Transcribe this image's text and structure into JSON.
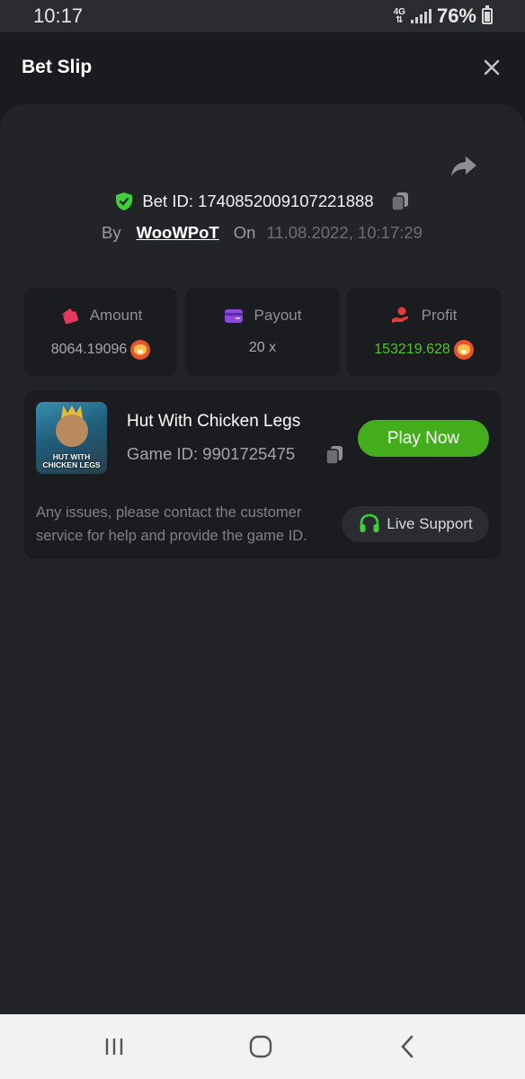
{
  "status_bar": {
    "time": "10:17",
    "network": "4G",
    "battery": "76%"
  },
  "header": {
    "title": "Bet Slip"
  },
  "bet": {
    "id_text": "Bet ID: 1740852009107221888",
    "by_label": "By",
    "user": "WooWPoT",
    "on_label": "On",
    "date": "11.08.2022, 10:17:29"
  },
  "stats": [
    {
      "label": "Amount",
      "value": "8064.19096",
      "icon": "wallet-icon",
      "color": "#e6395f"
    },
    {
      "label": "Payout",
      "value": "20 x",
      "icon": "card-icon",
      "color": "#8a4bdc"
    },
    {
      "label": "Profit",
      "value": "153219.628",
      "icon": "hand-coin-icon",
      "color": "#e63a34"
    }
  ],
  "game": {
    "title": "Hut With Chicken Legs",
    "game_id_text": "Game ID: 9901725475",
    "thumb_text": "HUT WITH CHICKEN LEGS",
    "play_label": "Play Now",
    "issue_text": "Any issues, please contact the customer service for help and provide the game ID.",
    "support_label": "Live Support"
  },
  "colors": {
    "accent": "#44ad1c",
    "profit": "#53c22b",
    "shield": "#3fcf3a"
  }
}
